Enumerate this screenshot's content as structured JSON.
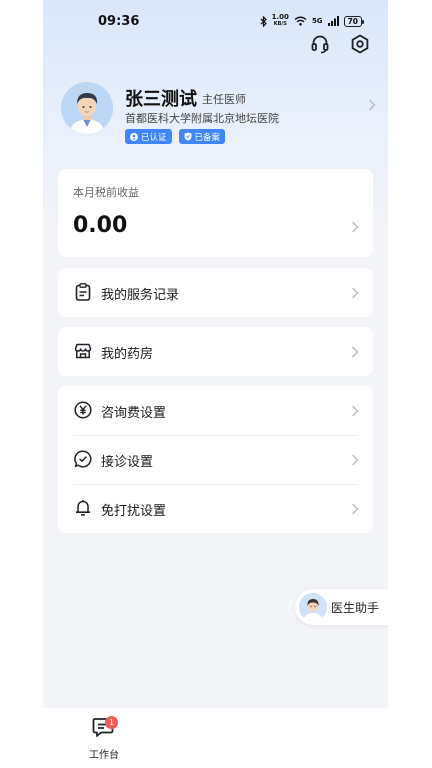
{
  "status_bar": {
    "time": "09:36",
    "speed_value": "1.00",
    "speed_unit": "KB/S",
    "network": "5G",
    "battery": "70"
  },
  "header": {
    "support_icon": "headset-icon",
    "settings_icon": "settings-hexagon-icon"
  },
  "profile": {
    "name": "张三测试",
    "title": "主任医师",
    "hospital": "首都医科大学附属北京地坛医院",
    "badges": [
      {
        "label": "已认证",
        "icon": "person-verified-icon"
      },
      {
        "label": "已备案",
        "icon": "shield-icon"
      }
    ]
  },
  "income": {
    "label": "本月税前收益",
    "value": "0.00"
  },
  "menu": {
    "service_records": "我的服务记录",
    "pharmacy": "我的药房",
    "consult_fee": "咨询费设置",
    "consultation": "接诊设置",
    "do_not_disturb": "免打扰设置"
  },
  "assistant": {
    "label": "医生助手"
  },
  "tabbar": {
    "workbench_label": "工作台",
    "workbench_badge": "1"
  },
  "colors": {
    "accent": "#4285f4",
    "badge_red": "#f25c54",
    "background": "#f3f5f8"
  }
}
